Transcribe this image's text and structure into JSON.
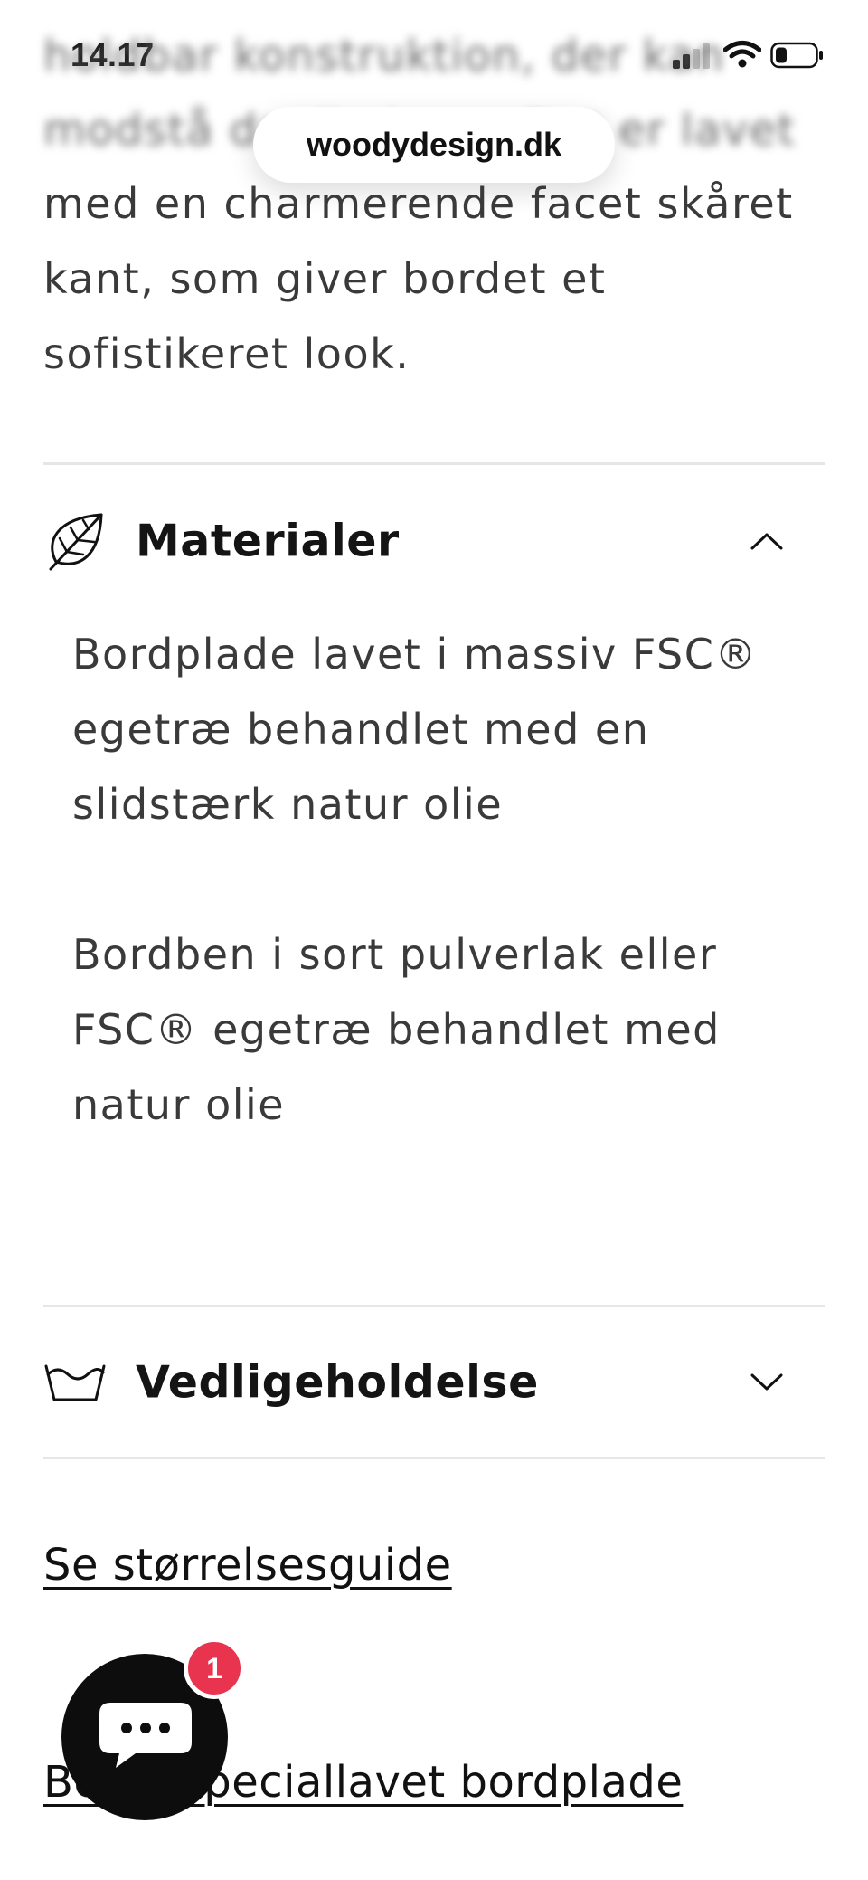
{
  "status_bar": {
    "time": "14.17"
  },
  "browser": {
    "url": "woodydesign.dk"
  },
  "description": {
    "blurred_line_1": "holdbar konstruktion, der kan",
    "blurred_line_2": "modstå daglig brug. Det er lavet",
    "line_3": "med en charmerende facet skåret",
    "line_4": "kant, som giver bordet et",
    "line_5": "sofistikeret look."
  },
  "accordions": [
    {
      "title": "Materialer",
      "icon": "leaf-icon",
      "expanded": true,
      "paragraphs": [
        "Bordplade lavet i massiv FSC® egetræ behandlet med en slidstærk natur olie",
        "Bordben i sort pulverlak eller FSC® egetræ behandlet med natur olie"
      ]
    },
    {
      "title": "Vedligeholdelse",
      "icon": "washing-tub-icon",
      "expanded": false
    }
  ],
  "links": {
    "size_guide": "Se størrelsesguide",
    "custom_tabletop": "Bestil speciallavet bordplade"
  },
  "chat": {
    "badge_count": "1",
    "icon": "chat-bubble-icon"
  },
  "colors": {
    "badge": "#e8344f",
    "chat_button": "#0d0d0d",
    "divider": "#e6e6e6"
  }
}
